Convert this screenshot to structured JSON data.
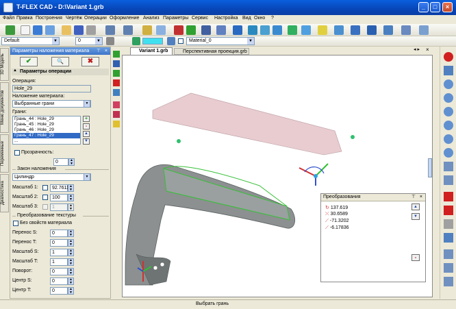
{
  "window": {
    "title": "T-FLEX CAD - D:\\Variant 1.grb"
  },
  "menu": [
    "Файл",
    "Правка",
    "Построения",
    "Чертёж",
    "Операции",
    "Оформление",
    "Анализ",
    "Параметры",
    "Сервис",
    "Настройка",
    "Вид",
    "Окно",
    "?"
  ],
  "toolbar": {
    "style_combo": "Default",
    "layer_combo": "0",
    "material_combo": "Material_0"
  },
  "tabs": [
    "Variant 1.grb",
    "Перспективная проекция.grb"
  ],
  "left_vtabs": [
    "3D Модель",
    "Меню документов",
    "Переменные",
    "Диагностика"
  ],
  "panel": {
    "header": "Параметры наложения материала",
    "section": "Параметры операции",
    "operation_label": "Операция:",
    "operation_value": "Hole_29",
    "mapping_label": "Наложение материала:",
    "mapping_value": "Выбранные грани",
    "faces_label": "Грани:",
    "faces": [
      "Грань_44 : Hole_29",
      "Грань_45 : Hole_29",
      "Грань_46 : Hole_29",
      "Грань_47 : Hole_29",
      "..."
    ],
    "transparency_label": "Прозрачность:",
    "transparency_value": "0",
    "law_label": "Закон наложения",
    "law_value": "Цилиндр",
    "scale1_label": "Масштаб 1:",
    "scale1_value": "92.7611",
    "scale2_label": "Масштаб 2:",
    "scale2_value": "100",
    "scale3_label": "Масштаб 3:",
    "scale3_value": "1",
    "texture_label": "Преобразование текстуры",
    "no_props_label": "Без свойств материала",
    "rows": [
      {
        "label": "Перенос S:",
        "value": "0"
      },
      {
        "label": "Перенос T:",
        "value": "0"
      },
      {
        "label": "Масштаб S:",
        "value": "1"
      },
      {
        "label": "Масштаб T:",
        "value": "1"
      },
      {
        "label": "Поворот:",
        "value": "0"
      },
      {
        "label": "Центр S:",
        "value": "0"
      },
      {
        "label": "Центр T:",
        "value": "0"
      }
    ]
  },
  "transform_panel": {
    "title": "Преобразования",
    "values": [
      "137.619",
      "30.6589",
      "-71.3202",
      "-6.17836"
    ]
  },
  "status": {
    "text": "Выбрать грань"
  },
  "colors": {
    "titlebar": "#0a46b8",
    "accent_green": "#2fa84a",
    "model_gray": "#8c9090",
    "roof_pink": "#e8c8cc",
    "edge_green": "#38c038"
  }
}
